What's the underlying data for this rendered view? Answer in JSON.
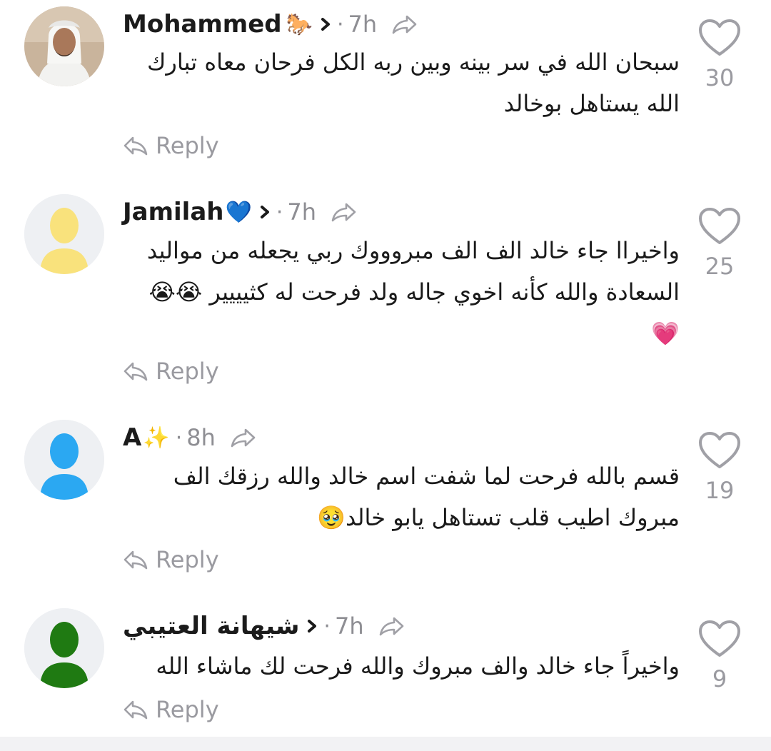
{
  "comments": [
    {
      "username": "Mohammed",
      "name_emoji": "🐎",
      "time": "7h",
      "text_lines": [
        "سبحان الله في سر بينه وبين ربه الكل فرحان معاه تبارك",
        "الله يستاهل بوخالد"
      ],
      "reply_label": "Reply",
      "likes": "30",
      "avatar": "photo-man-white-headdress"
    },
    {
      "username": "Jamilah",
      "name_emoji": "💙",
      "time": "7h",
      "text_lines": [
        "واخيراا جاء خالد الف الف مبروووك ربي يجعله من مواليد",
        "السعادة والله كأنه اخوي جاله ولد فرحت له كثيييير 😭😭",
        "💗"
      ],
      "reply_label": "Reply",
      "likes": "25",
      "avatar_color": "#f9e27c"
    },
    {
      "username": "A",
      "name_emoji": "✨",
      "time": "8h",
      "text_lines": [
        "قسم بالله فرحت لما شفت اسم خالد والله رزقك الف",
        "مبروك اطيب قلب تستاهل يابو خالد🥹"
      ],
      "reply_label": "Reply",
      "likes": "19",
      "avatar_color": "#2ba8f2"
    },
    {
      "username": "شيهانة العتيبي",
      "name_emoji": "",
      "time": "7h",
      "text_lines": [
        "واخيراً جاء خالد والف مبروك والله فرحت لك ماشاء الله"
      ],
      "reply_label": "Reply",
      "likes": "9",
      "avatar_color": "#1f7a12"
    }
  ],
  "colors": {
    "secondary_text": "#8e8e93",
    "icon_gray": "#a0a0a6"
  }
}
